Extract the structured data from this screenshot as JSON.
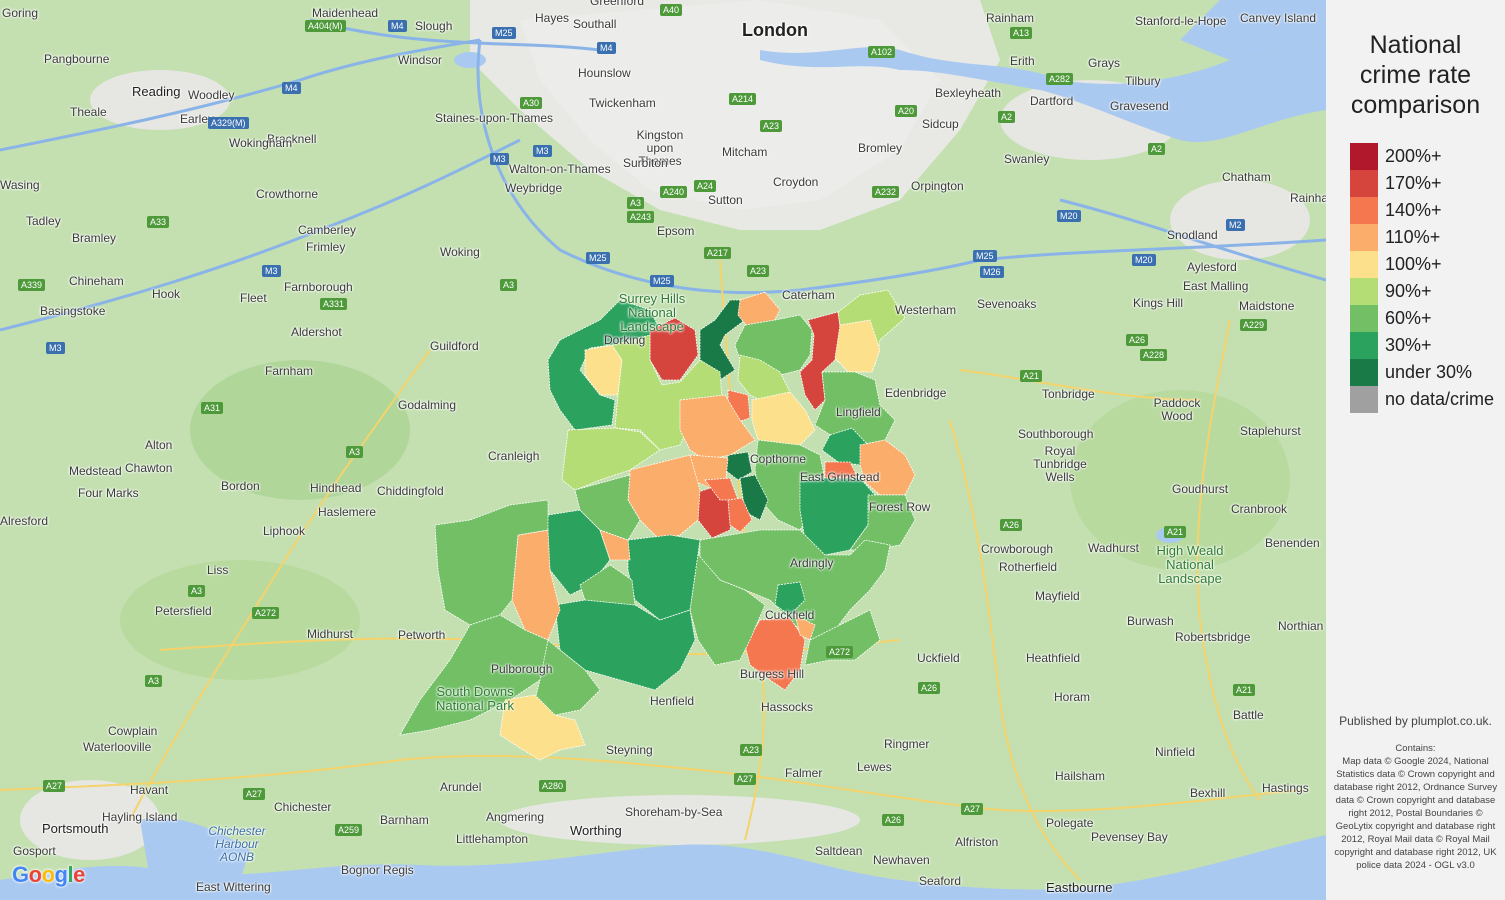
{
  "legend": {
    "title": "National\ncrime rate\ncomparison",
    "items": [
      {
        "label": "200%+",
        "color": "#b2182b"
      },
      {
        "label": "170%+",
        "color": "#d6453d"
      },
      {
        "label": "140%+",
        "color": "#f4774f"
      },
      {
        "label": "110%+",
        "color": "#fbae6c"
      },
      {
        "label": "100%+",
        "color": "#fde08b"
      },
      {
        "label": "90%+",
        "color": "#b5dd75"
      },
      {
        "label": "60%+",
        "color": "#72bf66"
      },
      {
        "label": "30%+",
        "color": "#2ca25f"
      },
      {
        "label": "under 30%",
        "color": "#1a7a47"
      },
      {
        "label": "no data/crime",
        "color": "#a0a0a0"
      }
    ]
  },
  "attribution": {
    "published": "Published by plumplot.co.uk.",
    "contains_title": "Contains:",
    "contains_text": "Map data © Google 2024, National Statistics data © Crown copyright and database right 2012, Ordnance Survey data © Crown copyright and database right 2012, Postal Boundaries © GeoLytix copyright and database right 2012, Royal Mail data © Royal Mail copyright and database right 2012, UK police data 2024 - OGL v3.0"
  },
  "google_logo": {
    "letters": [
      "G",
      "o",
      "o",
      "g",
      "l",
      "e"
    ],
    "colors": [
      "#4285f4",
      "#ea4335",
      "#fbbc05",
      "#4285f4",
      "#34a853",
      "#ea4335"
    ]
  },
  "places": [
    {
      "name": "Goring"
    },
    {
      "name": "Maidenhead"
    },
    {
      "name": "Slough"
    },
    {
      "name": "Hayes"
    },
    {
      "name": "Southall"
    },
    {
      "name": "Greenford"
    },
    {
      "name": "London"
    },
    {
      "name": "Rainham"
    },
    {
      "name": "Stanford-le-Hope"
    },
    {
      "name": "Canvey Island"
    },
    {
      "name": "Pangbourne"
    },
    {
      "name": "Windsor"
    },
    {
      "name": "Hounslow"
    },
    {
      "name": "Erith"
    },
    {
      "name": "Grays"
    },
    {
      "name": "Reading"
    },
    {
      "name": "Woodley"
    },
    {
      "name": "Twickenham"
    },
    {
      "name": "Bexleyheath"
    },
    {
      "name": "Dartford"
    },
    {
      "name": "Tilbury"
    },
    {
      "name": "Theale"
    },
    {
      "name": "Earley"
    },
    {
      "name": "Gravesend"
    },
    {
      "name": "Bracknell"
    },
    {
      "name": "Staines-upon-Thames"
    },
    {
      "name": "Kingston upon Thames"
    },
    {
      "name": "Sidcup"
    },
    {
      "name": "Wokingham"
    },
    {
      "name": "Mitcham"
    },
    {
      "name": "Bromley"
    },
    {
      "name": "Surbiton"
    },
    {
      "name": "Swanley"
    },
    {
      "name": "Chatham"
    },
    {
      "name": "Walton-on-Thames"
    },
    {
      "name": "Croydon"
    },
    {
      "name": "Orpington"
    },
    {
      "name": "Wasing"
    },
    {
      "name": "Crowthorne"
    },
    {
      "name": "Weybridge"
    },
    {
      "name": "Rainha"
    },
    {
      "name": "Tadley"
    },
    {
      "name": "Sutton"
    },
    {
      "name": "Camberley"
    },
    {
      "name": "Bramley"
    },
    {
      "name": "Frimley"
    },
    {
      "name": "Epsom"
    },
    {
      "name": "Snodland"
    },
    {
      "name": "Woking"
    },
    {
      "name": "Chineham"
    },
    {
      "name": "Farnborough"
    },
    {
      "name": "East Malling"
    },
    {
      "name": "Aylesford"
    },
    {
      "name": "Caterham"
    },
    {
      "name": "Basingstoke"
    },
    {
      "name": "Hook"
    },
    {
      "name": "Fleet"
    },
    {
      "name": "Sevenoaks"
    },
    {
      "name": "Kings Hill"
    },
    {
      "name": "Maidstone"
    },
    {
      "name": "Westerham"
    },
    {
      "name": "Aldershot"
    },
    {
      "name": "Guildford"
    },
    {
      "name": "Farnham"
    },
    {
      "name": "Edenbridge"
    },
    {
      "name": "Tonbridge"
    },
    {
      "name": "Godalming"
    },
    {
      "name": "Paddock Wood"
    },
    {
      "name": "Alton"
    },
    {
      "name": "Chawton"
    },
    {
      "name": "Cranleigh"
    },
    {
      "name": "Southborough"
    },
    {
      "name": "Staplehurst"
    },
    {
      "name": "Medstead"
    },
    {
      "name": "Royal Tunbridge Wells"
    },
    {
      "name": "Four Marks"
    },
    {
      "name": "Bordon"
    },
    {
      "name": "Hindhead"
    },
    {
      "name": "Chiddingfold"
    },
    {
      "name": "Goudhurst"
    },
    {
      "name": "Alresford"
    },
    {
      "name": "Haslemere"
    },
    {
      "name": "Cranbrook"
    },
    {
      "name": "Liphook"
    },
    {
      "name": "Crowborough"
    },
    {
      "name": "Wadhurst"
    },
    {
      "name": "High Weald National Landscape"
    },
    {
      "name": "Benenden"
    },
    {
      "name": "Rotherfield"
    },
    {
      "name": "Liss"
    },
    {
      "name": "Mayfield"
    },
    {
      "name": "Petersfield"
    },
    {
      "name": "Burwash"
    },
    {
      "name": "Northian"
    },
    {
      "name": "Midhurst"
    },
    {
      "name": "Petworth"
    },
    {
      "name": "Robertsbridge"
    },
    {
      "name": "Uckfield"
    },
    {
      "name": "Heathfield"
    },
    {
      "name": "Henfield"
    },
    {
      "name": "Hassocks"
    },
    {
      "name": "Horam"
    },
    {
      "name": "Battle"
    },
    {
      "name": "Cowplain"
    },
    {
      "name": "Waterlooville"
    },
    {
      "name": "Steyning"
    },
    {
      "name": "Ringmer"
    },
    {
      "name": "Ninfield"
    },
    {
      "name": "Falmer"
    },
    {
      "name": "Lewes"
    },
    {
      "name": "Hailsham"
    },
    {
      "name": "Havant"
    },
    {
      "name": "Arundel"
    },
    {
      "name": "Bexhill"
    },
    {
      "name": "Hastings"
    },
    {
      "name": "Chichester"
    },
    {
      "name": "Shoreham-by-Sea"
    },
    {
      "name": "Hayling Island"
    },
    {
      "name": "Angmering"
    },
    {
      "name": "Portsmouth"
    },
    {
      "name": "Barnham"
    },
    {
      "name": "Worthing"
    },
    {
      "name": "Polegate"
    },
    {
      "name": "Chichester Harbour AONB"
    },
    {
      "name": "Littlehampton"
    },
    {
      "name": "Pevensey Bay"
    },
    {
      "name": "Alfriston"
    },
    {
      "name": "Gosport"
    },
    {
      "name": "Saltdean"
    },
    {
      "name": "Newhaven"
    },
    {
      "name": "Bognor Regis"
    },
    {
      "name": "East Wittering"
    },
    {
      "name": "Seaford"
    },
    {
      "name": "Eastbourne"
    },
    {
      "name": "Surrey Hills National Landscape"
    },
    {
      "name": "Lingfield"
    },
    {
      "name": "Copthorne"
    },
    {
      "name": "East Grinstead"
    },
    {
      "name": "Ardingly"
    },
    {
      "name": "Cuckfield"
    },
    {
      "name": "Pulborough"
    },
    {
      "name": "South Downs National Park"
    },
    {
      "name": "Burgess Hill"
    },
    {
      "name": "Dorking"
    },
    {
      "name": "Forest Row"
    }
  ],
  "roads": [
    {
      "name": "A404(M)"
    },
    {
      "name": "M4"
    },
    {
      "name": "M25"
    },
    {
      "name": "M4"
    },
    {
      "name": "A40"
    },
    {
      "name": "A13"
    },
    {
      "name": "A102"
    },
    {
      "name": "M4"
    },
    {
      "name": "A282"
    },
    {
      "name": "A30"
    },
    {
      "name": "A214"
    },
    {
      "name": "A20"
    },
    {
      "name": "A329(M)"
    },
    {
      "name": "A2"
    },
    {
      "name": "A23"
    },
    {
      "name": "M3"
    },
    {
      "name": "M3"
    },
    {
      "name": "A2"
    },
    {
      "name": "A240"
    },
    {
      "name": "A24"
    },
    {
      "name": "A232"
    },
    {
      "name": "A3"
    },
    {
      "name": "A33"
    },
    {
      "name": "A243"
    },
    {
      "name": "M20"
    },
    {
      "name": "M2"
    },
    {
      "name": "M25"
    },
    {
      "name": "A217"
    },
    {
      "name": "M3"
    },
    {
      "name": "A23"
    },
    {
      "name": "M25"
    },
    {
      "name": "M25"
    },
    {
      "name": "M26"
    },
    {
      "name": "M20"
    },
    {
      "name": "A339"
    },
    {
      "name": "A3"
    },
    {
      "name": "A331"
    },
    {
      "name": "A229"
    },
    {
      "name": "M3"
    },
    {
      "name": "A26"
    },
    {
      "name": "A228"
    },
    {
      "name": "A21"
    },
    {
      "name": "A31"
    },
    {
      "name": "A3"
    },
    {
      "name": "A26"
    },
    {
      "name": "A3"
    },
    {
      "name": "A21"
    },
    {
      "name": "A272"
    },
    {
      "name": "A272"
    },
    {
      "name": "A26"
    },
    {
      "name": "A21"
    },
    {
      "name": "A3"
    },
    {
      "name": "A23"
    },
    {
      "name": "A27"
    },
    {
      "name": "A27"
    },
    {
      "name": "A280"
    },
    {
      "name": "A27"
    },
    {
      "name": "A27"
    },
    {
      "name": "A259"
    },
    {
      "name": "A26"
    }
  ]
}
